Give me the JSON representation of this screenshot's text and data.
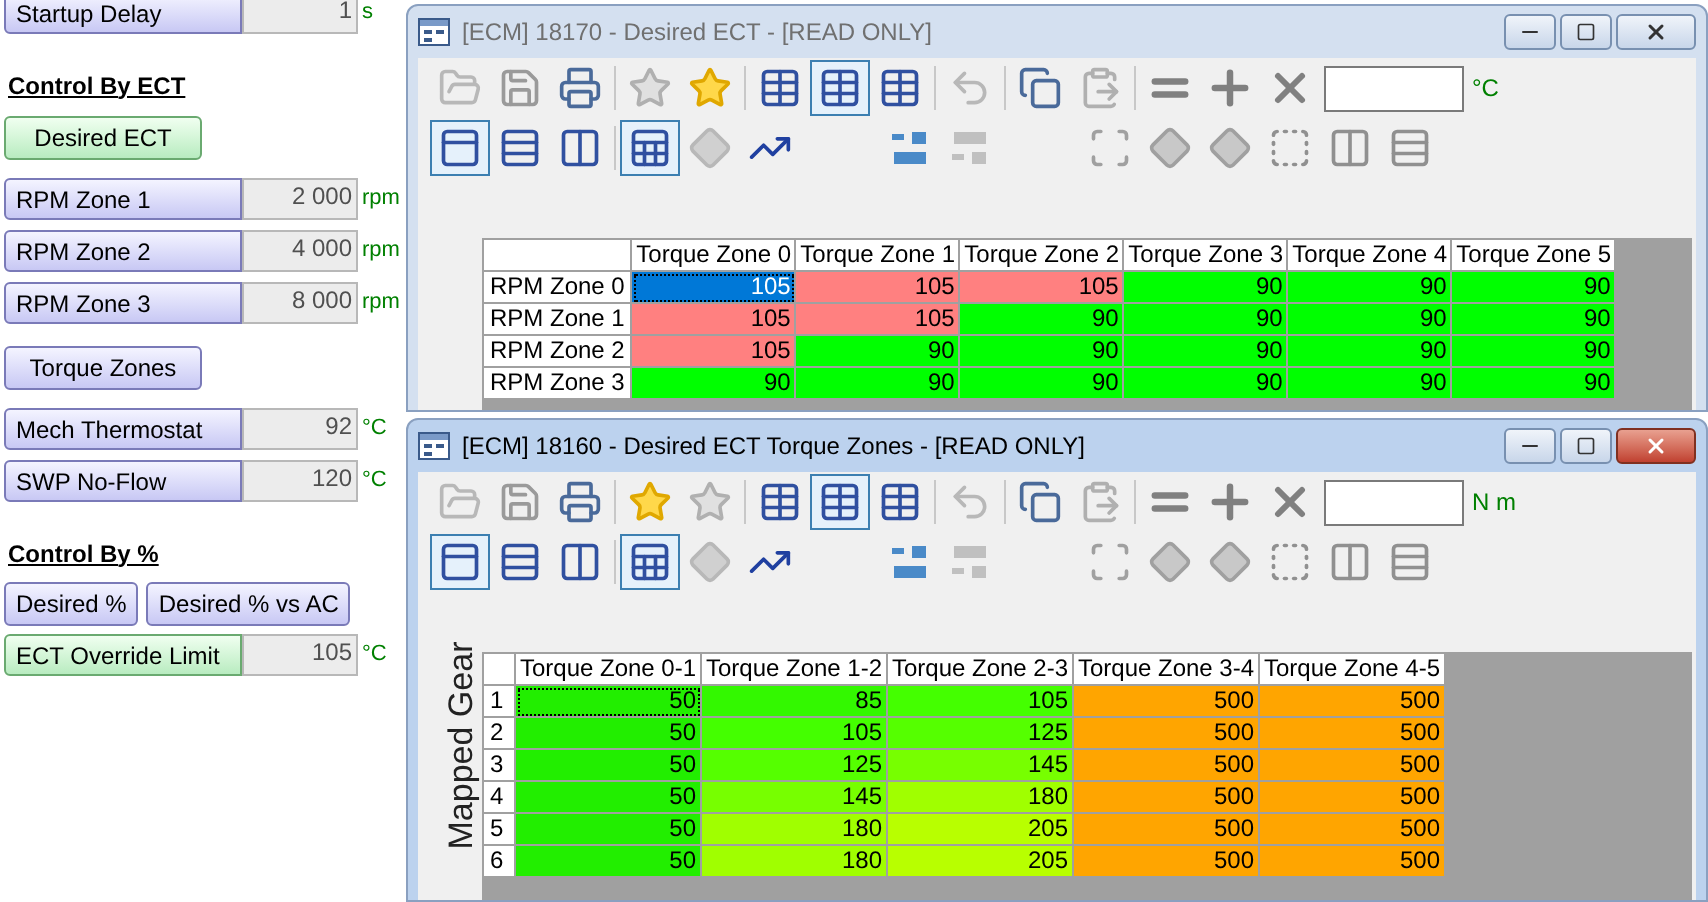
{
  "left_panel": [
    {
      "kind": "field",
      "label": "Startup Delay",
      "value": "1",
      "unit": "s",
      "highlighted": false
    },
    {
      "kind": "heading",
      "label": "Control By ECT"
    },
    {
      "kind": "button",
      "label": "Desired ECT",
      "highlighted": true
    },
    {
      "kind": "field",
      "label": "RPM Zone 1",
      "value": "2 000",
      "unit": "rpm",
      "highlighted": false
    },
    {
      "kind": "field",
      "label": "RPM Zone 2",
      "value": "4 000",
      "unit": "rpm",
      "highlighted": false
    },
    {
      "kind": "field",
      "label": "RPM Zone 3",
      "value": "8 000",
      "unit": "rpm",
      "highlighted": false
    },
    {
      "kind": "button",
      "label": "Torque Zones",
      "highlighted": false
    },
    {
      "kind": "field",
      "label": "Mech Thermostat",
      "value": "92",
      "unit": "°C",
      "highlighted": false
    },
    {
      "kind": "field",
      "label": "SWP No-Flow",
      "value": "120",
      "unit": "°C",
      "highlighted": false
    },
    {
      "kind": "heading",
      "label": "Control By %"
    },
    {
      "kind": "button_row",
      "buttons": [
        {
          "label": "Desired %",
          "highlighted": false
        },
        {
          "label": "Desired % vs AC",
          "highlighted": false
        }
      ]
    },
    {
      "kind": "field",
      "label": "ECT Override Limit",
      "value": "105",
      "unit": "°C",
      "highlighted": true
    }
  ],
  "windows": [
    {
      "title": "[ECM] 18170 - Desired ECT - [READ ONLY]",
      "active": false,
      "unit": "°C",
      "table": {
        "columns": [
          "Torque Zone 0",
          "Torque Zone 1",
          "Torque Zone 2",
          "Torque Zone 3",
          "Torque Zone 4",
          "Torque Zone 5"
        ],
        "rows": [
          {
            "header": "RPM Zone 0",
            "cells": [
              {
                "value": "105",
                "color": "#0078d7",
                "selected": true
              },
              {
                "value": "105",
                "color": "#ff8080",
                "selected": false
              },
              {
                "value": "105",
                "color": "#ff8080",
                "selected": false
              },
              {
                "value": "90",
                "color": "#00ff00",
                "selected": false
              },
              {
                "value": "90",
                "color": "#00ff00",
                "selected": false
              },
              {
                "value": "90",
                "color": "#00ff00",
                "selected": false
              }
            ]
          },
          {
            "header": "RPM Zone 1",
            "cells": [
              {
                "value": "105",
                "color": "#ff8080",
                "selected": false
              },
              {
                "value": "105",
                "color": "#ff8080",
                "selected": false
              },
              {
                "value": "90",
                "color": "#00ff00",
                "selected": false
              },
              {
                "value": "90",
                "color": "#00ff00",
                "selected": false
              },
              {
                "value": "90",
                "color": "#00ff00",
                "selected": false
              },
              {
                "value": "90",
                "color": "#00ff00",
                "selected": false
              }
            ]
          },
          {
            "header": "RPM Zone 2",
            "cells": [
              {
                "value": "105",
                "color": "#ff8080",
                "selected": false
              },
              {
                "value": "90",
                "color": "#00ff00",
                "selected": false
              },
              {
                "value": "90",
                "color": "#00ff00",
                "selected": false
              },
              {
                "value": "90",
                "color": "#00ff00",
                "selected": false
              },
              {
                "value": "90",
                "color": "#00ff00",
                "selected": false
              },
              {
                "value": "90",
                "color": "#00ff00",
                "selected": false
              }
            ]
          },
          {
            "header": "RPM Zone 3",
            "cells": [
              {
                "value": "90",
                "color": "#00ff00",
                "selected": false
              },
              {
                "value": "90",
                "color": "#00ff00",
                "selected": false
              },
              {
                "value": "90",
                "color": "#00ff00",
                "selected": false
              },
              {
                "value": "90",
                "color": "#00ff00",
                "selected": false
              },
              {
                "value": "90",
                "color": "#00ff00",
                "selected": false
              },
              {
                "value": "90",
                "color": "#00ff00",
                "selected": false
              }
            ]
          }
        ]
      }
    },
    {
      "title": "[ECM] 18160 - Desired ECT Torque Zones - [READ ONLY]",
      "active": true,
      "unit": "N m",
      "axis_label": "Mapped Gear",
      "table": {
        "columns": [
          "Torque Zone 0-1",
          "Torque Zone 1-2",
          "Torque Zone 2-3",
          "Torque Zone 3-4",
          "Torque Zone 4-5"
        ],
        "rows": [
          {
            "header": "1",
            "cells": [
              {
                "value": "50",
                "color": "#22ee00",
                "selected": true
              },
              {
                "value": "85",
                "color": "#33f800",
                "selected": false
              },
              {
                "value": "105",
                "color": "#44ff00",
                "selected": false
              },
              {
                "value": "500",
                "color": "#ffa500",
                "selected": false
              },
              {
                "value": "500",
                "color": "#ffa500",
                "selected": false
              }
            ]
          },
          {
            "header": "2",
            "cells": [
              {
                "value": "50",
                "color": "#22ee00",
                "selected": false
              },
              {
                "value": "105",
                "color": "#44ff00",
                "selected": false
              },
              {
                "value": "125",
                "color": "#55ff00",
                "selected": false
              },
              {
                "value": "500",
                "color": "#ffa500",
                "selected": false
              },
              {
                "value": "500",
                "color": "#ffa500",
                "selected": false
              }
            ]
          },
          {
            "header": "3",
            "cells": [
              {
                "value": "50",
                "color": "#22ee00",
                "selected": false
              },
              {
                "value": "125",
                "color": "#55ff00",
                "selected": false
              },
              {
                "value": "145",
                "color": "#77ff00",
                "selected": false
              },
              {
                "value": "500",
                "color": "#ffa500",
                "selected": false
              },
              {
                "value": "500",
                "color": "#ffa500",
                "selected": false
              }
            ]
          },
          {
            "header": "4",
            "cells": [
              {
                "value": "50",
                "color": "#22ee00",
                "selected": false
              },
              {
                "value": "145",
                "color": "#77ff00",
                "selected": false
              },
              {
                "value": "180",
                "color": "#a0ff00",
                "selected": false
              },
              {
                "value": "500",
                "color": "#ffa500",
                "selected": false
              },
              {
                "value": "500",
                "color": "#ffa500",
                "selected": false
              }
            ]
          },
          {
            "header": "5",
            "cells": [
              {
                "value": "50",
                "color": "#22ee00",
                "selected": false
              },
              {
                "value": "180",
                "color": "#a0ff00",
                "selected": false
              },
              {
                "value": "205",
                "color": "#b8ff00",
                "selected": false
              },
              {
                "value": "500",
                "color": "#ffa500",
                "selected": false
              },
              {
                "value": "500",
                "color": "#ffa500",
                "selected": false
              }
            ]
          },
          {
            "header": "6",
            "cells": [
              {
                "value": "50",
                "color": "#22ee00",
                "selected": false
              },
              {
                "value": "180",
                "color": "#a0ff00",
                "selected": false
              },
              {
                "value": "205",
                "color": "#b8ff00",
                "selected": false
              },
              {
                "value": "500",
                "color": "#ffa500",
                "selected": false
              },
              {
                "value": "500",
                "color": "#ffa500",
                "selected": false
              }
            ]
          }
        ]
      }
    }
  ]
}
